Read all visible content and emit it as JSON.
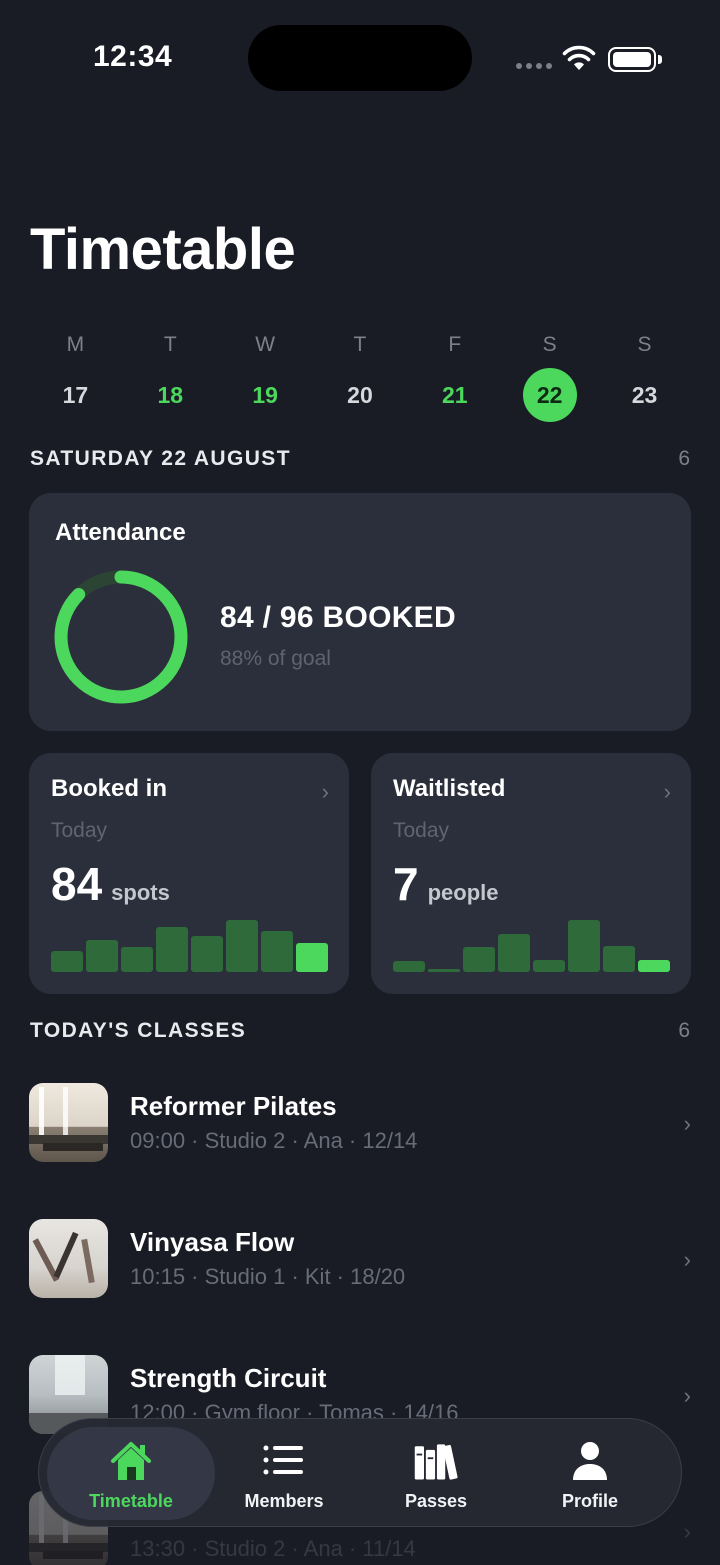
{
  "status": {
    "time": "12:34"
  },
  "header": {
    "title": "Timetable"
  },
  "week": [
    {
      "dow": "M",
      "date": "17",
      "state": "none"
    },
    {
      "dow": "T",
      "date": "18",
      "state": "has"
    },
    {
      "dow": "W",
      "date": "19",
      "state": "has"
    },
    {
      "dow": "T",
      "date": "20",
      "state": "none"
    },
    {
      "dow": "F",
      "date": "21",
      "state": "has"
    },
    {
      "dow": "S",
      "date": "22",
      "state": "selected"
    },
    {
      "dow": "S",
      "date": "23",
      "state": "none"
    }
  ],
  "day_section": {
    "heading": "SATURDAY 22 AUGUST",
    "count": "6"
  },
  "attendance": {
    "title": "Attendance",
    "value": "84 / 96 BOOKED",
    "subtitle": "88% of goal",
    "progress": 0.875
  },
  "booked": {
    "title": "Booked in",
    "period": "Today",
    "value": "84",
    "unit": "spots",
    "bars": [
      0.4,
      0.62,
      0.48,
      0.86,
      0.7,
      1.0,
      0.78,
      0.56
    ]
  },
  "waitlisted": {
    "title": "Waitlisted",
    "period": "Today",
    "value": "7",
    "unit": "people",
    "bars": [
      0.22,
      0.06,
      0.48,
      0.74,
      0.24,
      1.0,
      0.5,
      0.24
    ]
  },
  "classes_section": {
    "heading": "TODAY'S CLASSES",
    "count": "6"
  },
  "classes": [
    {
      "name": "Reformer Pilates",
      "meta": "09:00 · Studio 2 · Ana · 12/14",
      "thumb": "reformer-studio"
    },
    {
      "name": "Vinyasa Flow",
      "meta": "10:15 · Studio 1 · Kit · 18/20",
      "thumb": "yoga-class"
    },
    {
      "name": "Strength Circuit",
      "meta": "12:00 · Gym floor · Tomas · 14/16",
      "thumb": "gym-floor"
    },
    {
      "name": "",
      "meta": "13:30 · Studio 2 · Ana · 11/14",
      "thumb": "reformer-studio"
    }
  ],
  "tabbar": {
    "tabs": [
      {
        "label": "Timetable",
        "icon": "house-icon",
        "active": true
      },
      {
        "label": "Members",
        "icon": "list-icon",
        "active": false
      },
      {
        "label": "Passes",
        "icon": "books-icon",
        "active": false
      },
      {
        "label": "Profile",
        "icon": "person-icon",
        "active": false
      }
    ]
  },
  "colors": {
    "accent": "#4cd85c",
    "background": "#1a1c25",
    "card": "#2b2f3b",
    "bar_dim": "#2f6b3a"
  }
}
